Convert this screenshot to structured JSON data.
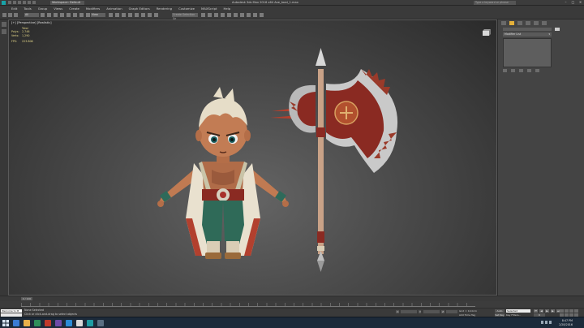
{
  "titlebar": {
    "workspace": "Workspace: Default",
    "title": "Autodesk 3ds Max 2016 x64   Axe_toad_1.max",
    "search_placeholder": "Type a keyword or phrase"
  },
  "menu": {
    "items": [
      "Edit",
      "Tools",
      "Group",
      "Views",
      "Create",
      "Modifiers",
      "Animation",
      "Graph Editors",
      "Rendering",
      "Customize",
      "MAXScript",
      "Help"
    ]
  },
  "toolbar": {
    "selection_filter": "All",
    "ref_coord": "View",
    "named_selection": "Create Selection Se"
  },
  "viewport": {
    "label": "[+] [Perspective] [Realistic]",
    "stats": {
      "header": "Total",
      "rows": [
        {
          "label": "Polys:",
          "value": "2,746"
        },
        {
          "label": "Verts:",
          "value": "1,290"
        },
        {
          "label": "FPS:",
          "value": "223.806"
        }
      ]
    }
  },
  "command_panel": {
    "modifier_list": "Modifier List"
  },
  "timeline": {
    "slider": "0 / 100"
  },
  "status": {
    "maxscript_1": "Welcome to M",
    "maxscript_2": "",
    "selection": "None Selected",
    "prompt": "Click or click-and-drag to select objects",
    "x_label": "X:",
    "y_label": "Y:",
    "z_label": "Z:",
    "grid": "Grid = 10.0cm",
    "add_time_tag": "Add Time Tag",
    "auto_key": "Auto Key",
    "selected": "Selected",
    "set_key": "Set Key",
    "key_filters": "Key Filters...",
    "frame": "0"
  },
  "taskbar": {
    "time": "8:47 PM",
    "date": "2/28/2016"
  },
  "colors": {
    "accent": "#19a3a8",
    "active_tab": "#e4b03a",
    "stats_text": "#e6d98a"
  }
}
